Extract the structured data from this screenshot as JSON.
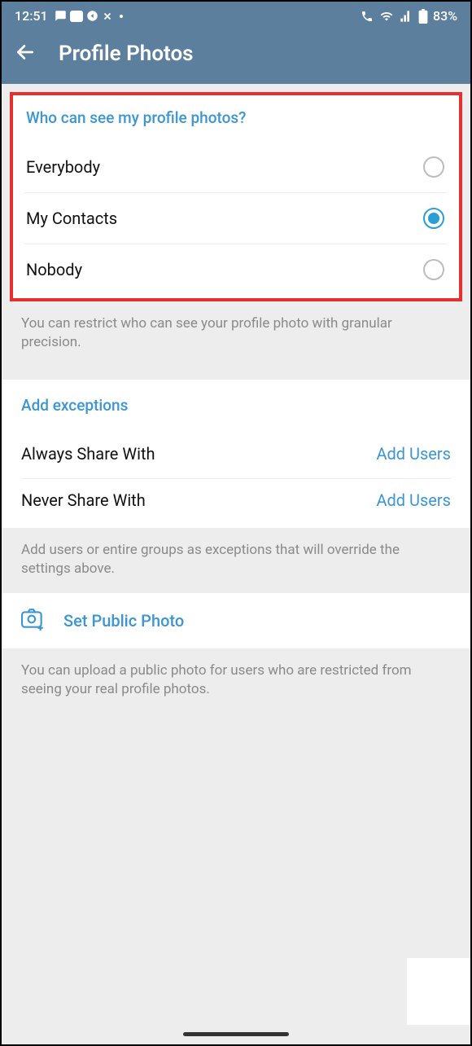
{
  "statusBar": {
    "time": "12:51",
    "battery": "83%"
  },
  "header": {
    "title": "Profile Photos"
  },
  "visibility": {
    "title": "Who can see my profile photos?",
    "options": [
      {
        "label": "Everybody",
        "selected": false
      },
      {
        "label": "My Contacts",
        "selected": true
      },
      {
        "label": "Nobody",
        "selected": false
      }
    ],
    "help": "You can restrict who can see your profile photo with granular precision."
  },
  "exceptions": {
    "title": "Add exceptions",
    "rows": [
      {
        "label": "Always Share With",
        "action": "Add Users"
      },
      {
        "label": "Never Share With",
        "action": "Add Users"
      }
    ],
    "help": "Add users or entire groups as exceptions that will override the settings above."
  },
  "publicPhoto": {
    "label": "Set Public Photo",
    "help": "You can upload a public photo for users who are restricted from seeing your real profile photos."
  }
}
